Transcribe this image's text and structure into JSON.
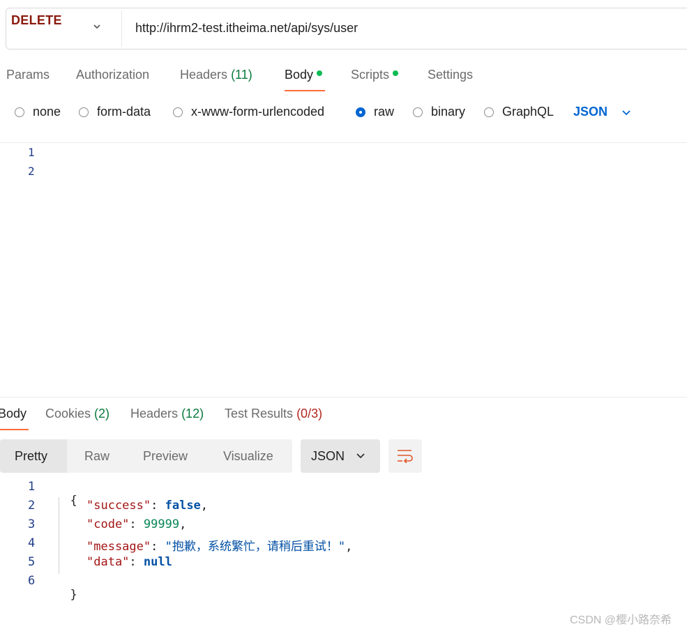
{
  "request": {
    "method": "DELETE",
    "url": "http://ihrm2-test.itheima.net/api/sys/user"
  },
  "request_tabs": {
    "params": "Params",
    "authorization": "Authorization",
    "headers": "Headers",
    "headers_count": "(11)",
    "body": "Body",
    "scripts": "Scripts",
    "settings": "Settings"
  },
  "body_types": {
    "none": "none",
    "form_data": "form-data",
    "urlencoded": "x-www-form-urlencoded",
    "raw": "raw",
    "binary": "binary",
    "graphql": "GraphQL",
    "selected": "raw",
    "language": "JSON"
  },
  "editor": {
    "line_numbers": [
      "1",
      "2"
    ]
  },
  "response_tabs": {
    "body": "Body",
    "cookies": "Cookies",
    "cookies_count": "(2)",
    "headers": "Headers",
    "headers_count": "(12)",
    "test_results": "Test Results",
    "test_results_count": "(0/3)"
  },
  "view_modes": {
    "pretty": "Pretty",
    "raw": "Raw",
    "preview": "Preview",
    "visualize": "Visualize",
    "format": "JSON"
  },
  "response": {
    "line_numbers": [
      "1",
      "2",
      "3",
      "4",
      "5",
      "6"
    ],
    "open_brace": "{",
    "close_brace": "}",
    "k_success": "\"success\"",
    "v_success": "false",
    "k_code": "\"code\"",
    "v_code": "99999",
    "k_message": "\"message\"",
    "v_message": "\"抱歉，系统繁忙，请稍后重试！\"",
    "k_data": "\"data\"",
    "v_data": "null"
  },
  "watermark": "CSDN @樱小路奈希",
  "colors": {
    "accent_underline": "#ff6c37",
    "method": "#8a1a0e",
    "link_blue": "#0265d2",
    "status_dot": "#0cbb52"
  }
}
